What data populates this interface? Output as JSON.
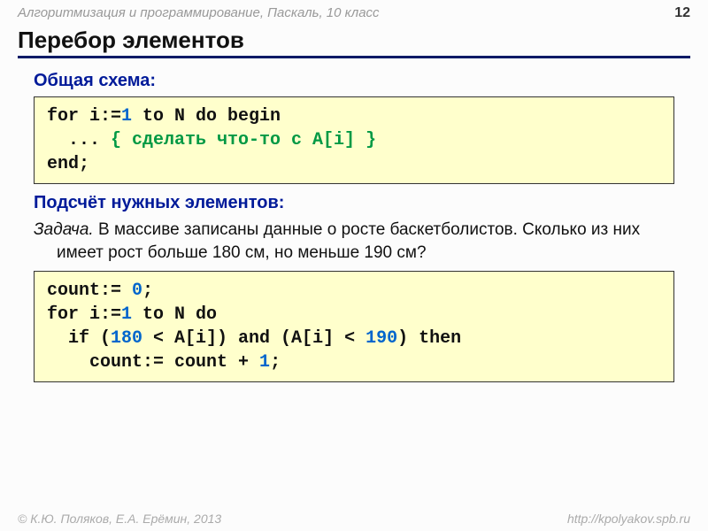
{
  "header": {
    "course_title": "Алгоритмизация и программирование, Паскаль, 10 класс",
    "page_number": "12"
  },
  "title": "Перебор элементов",
  "section1": {
    "heading": "Общая схема:",
    "code": {
      "l1a": "for i:=",
      "l1b": "1",
      "l1c": " to N do begin",
      "l2a": "  ... ",
      "l2b": "{ сделать что-то с A[i] }",
      "l3": "end;"
    }
  },
  "section2": {
    "heading": "Подсчёт нужных элементов:",
    "task_label": "Задача.",
    "task_text": " В массиве записаны данные о росте баскетболистов. Сколько из них имеет рост больше 180 см, но меньше 190 см?",
    "code": {
      "l1a": "count:= ",
      "l1b": "0",
      "l1c": ";",
      "l2a": "for i:=",
      "l2b": "1",
      "l2c": " to N do",
      "l3a": "  if (",
      "l3b": "180",
      "l3c": " < A[i]) and (A[i] < ",
      "l3d": "190",
      "l3e": ") then",
      "l4a": "    count:= count + ",
      "l4b": "1",
      "l4c": ";"
    }
  },
  "footer": {
    "copyright": "© К.Ю. Поляков, Е.А. Ерёмин, 2013",
    "url": "http://kpolyakov.spb.ru"
  }
}
